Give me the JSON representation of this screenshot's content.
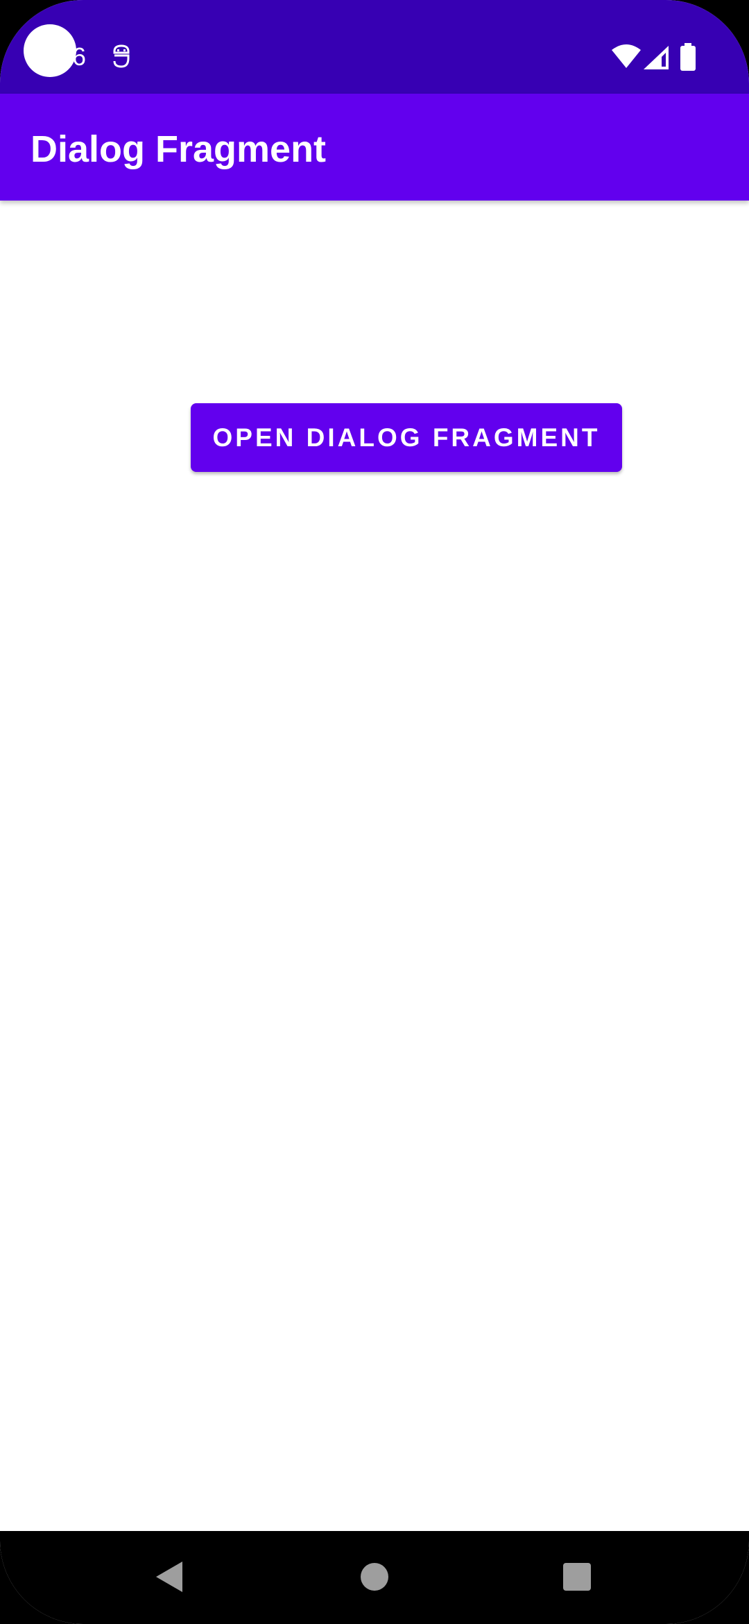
{
  "status_bar": {
    "time": "6",
    "background_color": "#3700b3",
    "icons": [
      "notification-icon",
      "wifi-icon",
      "signal-icon",
      "battery-icon"
    ]
  },
  "app_bar": {
    "title": "Dialog Fragment",
    "background_color": "#6200ee"
  },
  "main": {
    "open_dialog_button_label": "OPEN DIALOG FRAGMENT",
    "button_color": "#6200ee"
  },
  "nav_bar": {
    "buttons": [
      "back-icon",
      "home-icon",
      "recents-icon"
    ],
    "icon_color": "#9e9e9e"
  }
}
